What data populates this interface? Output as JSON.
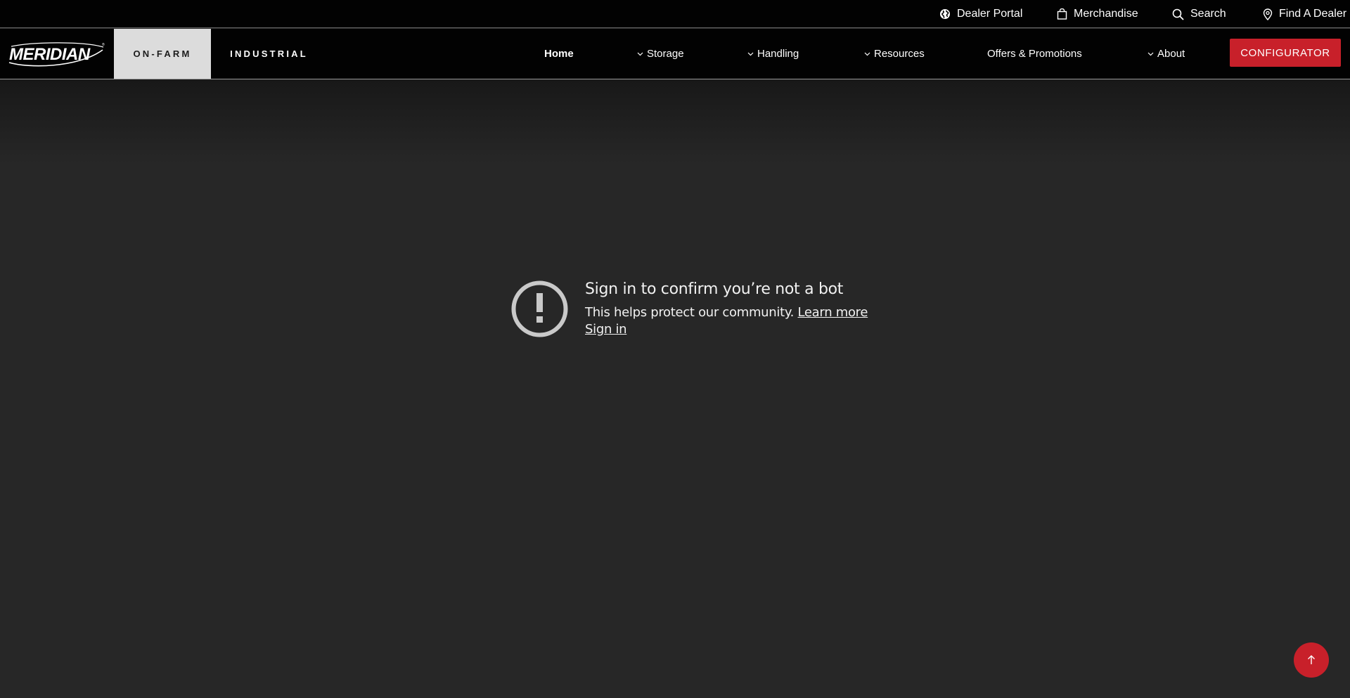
{
  "utility": {
    "dealer_portal": "Dealer Portal",
    "merchandise": "Merchandise",
    "search": "Search",
    "find_dealer": "Find A Dealer"
  },
  "nav": {
    "logo_text": "MERIDIAN",
    "segments": [
      "ON-FARM",
      "INDUSTRIAL"
    ],
    "active_segment": "ON-FARM",
    "items": [
      {
        "label": "Home",
        "dropdown": false,
        "active": true
      },
      {
        "label": "Storage",
        "dropdown": true
      },
      {
        "label": "Handling",
        "dropdown": true
      },
      {
        "label": "Resources",
        "dropdown": true
      },
      {
        "label": "Offers & Promotions",
        "dropdown": false
      },
      {
        "label": "About",
        "dropdown": true
      }
    ],
    "cta": "CONFIGURATOR"
  },
  "notice": {
    "title": "Sign in to confirm you’re not a bot",
    "description": "This helps protect our community.",
    "learn_more": "Learn more",
    "sign_in": "Sign in"
  },
  "colors": {
    "accent": "#c8202a",
    "page_bg": "#272727",
    "header_bg": "#020202"
  },
  "icons": {
    "dealer_portal": "globe-icon",
    "merchandise": "shopping-bag-icon",
    "search": "search-icon",
    "find_dealer": "map-pin-icon",
    "notice": "exclamation-circle-icon",
    "back_to_top": "arrow-up-icon"
  }
}
